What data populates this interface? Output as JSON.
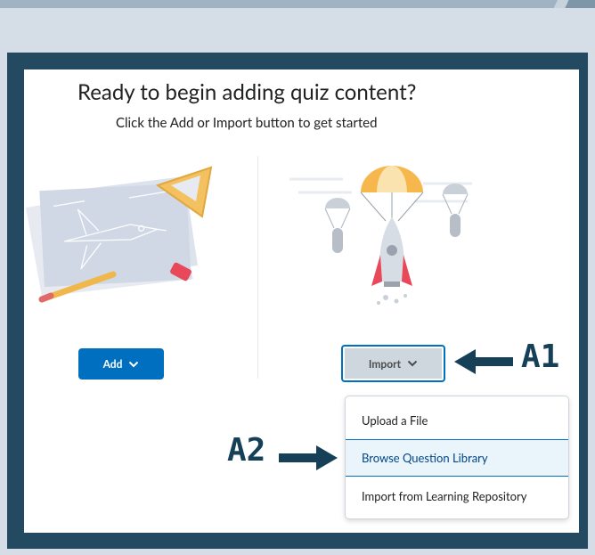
{
  "heading": "Ready to begin adding quiz content?",
  "subheading": "Click the Add or Import button to get started",
  "add_button": {
    "label": "Add"
  },
  "import_button": {
    "label": "Import"
  },
  "import_menu": {
    "items": [
      {
        "label": "Upload a File"
      },
      {
        "label": "Browse Question Library"
      },
      {
        "label": "Import from Learning Repository"
      }
    ],
    "highlighted_index": 1
  },
  "annotations": {
    "a1": "A1",
    "a2": "A2"
  },
  "icons": {
    "add_illustration": "blueprint-icon",
    "import_illustration": "rocket-parachute-icon",
    "chevron": "chevron-down-icon",
    "callout_arrow": "arrow-icon"
  },
  "colors": {
    "primary": "#006fbf",
    "frame": "#234a61",
    "callout": "#163f58",
    "highlight": "#e9f4fb"
  }
}
